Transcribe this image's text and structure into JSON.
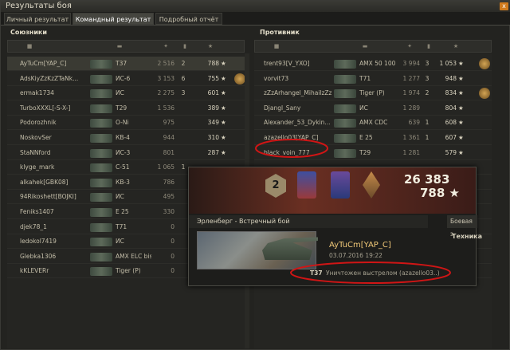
{
  "window": {
    "title": "Результаты боя",
    "close": "x"
  },
  "tabs": [
    {
      "label": "Личный результат"
    },
    {
      "label": "Командный результат"
    },
    {
      "label": "Подробный отчёт"
    }
  ],
  "allies": {
    "title": "Союзники"
  },
  "enemies": {
    "title": "Противник"
  },
  "ally_rows": [
    {
      "name": "AyTuCm[YAP_C]",
      "tank": "T37",
      "dmg": "2 516",
      "kills": "2",
      "xp": "788",
      "medal": false
    },
    {
      "name": "AdsKiyZzKzZTaNk...",
      "tank": "ИС-6",
      "dmg": "3 153",
      "kills": "6",
      "xp": "755",
      "medal": true
    },
    {
      "name": "ermak1734",
      "tank": "ИС",
      "dmg": "2 275",
      "kills": "3",
      "xp": "601",
      "medal": false
    },
    {
      "name": "TurboXXXL[-S-X-]",
      "tank": "T29",
      "dmg": "1 536",
      "kills": "",
      "xp": "389",
      "medal": false
    },
    {
      "name": "Podorozhnik",
      "tank": "O-Ni",
      "dmg": "975",
      "kills": "",
      "xp": "349",
      "medal": false
    },
    {
      "name": "NoskovSer",
      "tank": "КВ-4",
      "dmg": "944",
      "kills": "",
      "xp": "310",
      "medal": false
    },
    {
      "name": "StaNNford",
      "tank": "ИС-3",
      "dmg": "801",
      "kills": "",
      "xp": "287",
      "medal": false
    },
    {
      "name": "klyge_mark",
      "tank": "С-51",
      "dmg": "1 065",
      "kills": "1",
      "xp": "",
      "medal": false
    },
    {
      "name": "alkahek[GBK08]",
      "tank": "КВ-3",
      "dmg": "786",
      "kills": "",
      "xp": "",
      "medal": false
    },
    {
      "name": "94Rikoshett[BOJKI]",
      "tank": "ИС",
      "dmg": "495",
      "kills": "",
      "xp": "",
      "medal": false
    },
    {
      "name": "Feniks1407",
      "tank": "E 25",
      "dmg": "330",
      "kills": "",
      "xp": "",
      "medal": false
    },
    {
      "name": "djek78_1",
      "tank": "T71",
      "dmg": "0",
      "kills": "",
      "xp": "",
      "medal": false
    },
    {
      "name": "ledokol7419",
      "tank": "ИС",
      "dmg": "0",
      "kills": "",
      "xp": "",
      "medal": false
    },
    {
      "name": "Glebka1306",
      "tank": "AMX ELC bis",
      "dmg": "0",
      "kills": "",
      "xp": "",
      "medal": false
    },
    {
      "name": "kKLEVERr",
      "tank": "Tiger (P)",
      "dmg": "0",
      "kills": "",
      "xp": "133",
      "medal": false
    }
  ],
  "enemy_rows": [
    {
      "name": "trent93[V_YXO]",
      "tank": "AMX 50 100",
      "dmg": "3 994",
      "kills": "3",
      "xp": "1 053",
      "medal": true
    },
    {
      "name": "vorvit73",
      "tank": "T71",
      "dmg": "1 277",
      "kills": "3",
      "xp": "948",
      "medal": false
    },
    {
      "name": "zZzArhangel_MihailzZz",
      "tank": "Tiger (P)",
      "dmg": "1 974",
      "kills": "2",
      "xp": "834",
      "medal": true
    },
    {
      "name": "Djangl_Sany",
      "tank": "ИС",
      "dmg": "1 289",
      "kills": "",
      "xp": "804",
      "medal": false
    },
    {
      "name": "Alexander_53_Dykin...",
      "tank": "AMX CDC",
      "dmg": "639",
      "kills": "1",
      "xp": "608",
      "medal": false
    },
    {
      "name": "azazello03[YAP_C]",
      "tank": "E 25",
      "dmg": "1 361",
      "kills": "1",
      "xp": "607",
      "medal": false
    },
    {
      "name": "black_voin_777",
      "tank": "T29",
      "dmg": "1 281",
      "kills": "",
      "xp": "579",
      "medal": false
    },
    {
      "name": "",
      "tank": "",
      "dmg": "",
      "kills": "",
      "xp": "",
      "medal": false
    },
    {
      "name": "",
      "tank": "",
      "dmg": "",
      "kills": "",
      "xp": "",
      "medal": false
    },
    {
      "name": "",
      "tank": "",
      "dmg": "",
      "kills": "",
      "xp": "",
      "medal": false
    },
    {
      "name": "",
      "tank": "",
      "dmg": "",
      "kills": "",
      "xp": "",
      "medal": false
    },
    {
      "name": "",
      "tank": "",
      "dmg": "",
      "kills": "",
      "xp": "",
      "medal": false
    },
    {
      "name": "",
      "tank": "",
      "dmg": "",
      "kills": "",
      "xp": "",
      "medal": false
    },
    {
      "name": "",
      "tank": "",
      "dmg": "",
      "kills": "",
      "xp": "",
      "medal": false
    },
    {
      "name": "bel_eugene",
      "tank": "AMX ELC bis",
      "dmg": "0",
      "kills": "",
      "xp": "297",
      "medal": false
    }
  ],
  "popup": {
    "rank": "2",
    "credits": "26 383",
    "xp": "788",
    "map": "Эрленберг - Встречный бой",
    "right_tab": "Боевая э",
    "tech_label": "Техника",
    "player": "AyTuCm[YAP_C]",
    "date": "03.07.2016 19:22",
    "kill_tank": "T37",
    "kill_text": "Уничтожен выстрелом (azazello03..)"
  },
  "colors": {
    "accent": "#d07a1c",
    "annotation": "#d01515",
    "gold": "#f0c878"
  },
  "icons": {
    "star": "★",
    "close": "close-icon",
    "credit": "credit-icon"
  }
}
